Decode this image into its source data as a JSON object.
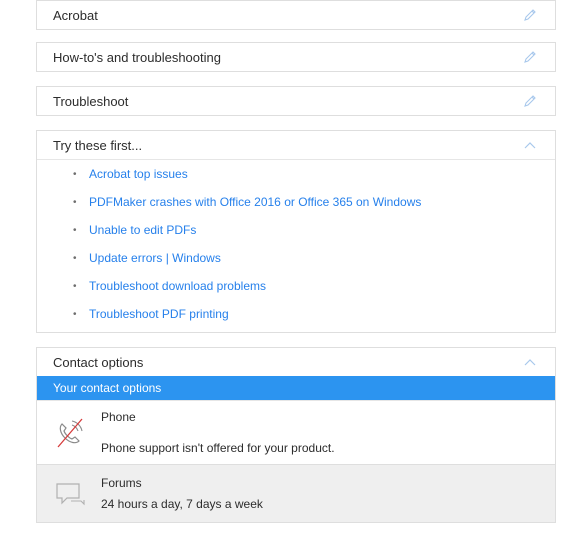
{
  "rows": {
    "acrobat": "Acrobat",
    "howto": "How-to's and troubleshooting",
    "troubleshoot": "Troubleshoot"
  },
  "try_first": {
    "title": "Try these first...",
    "links": [
      "Acrobat top issues",
      "PDFMaker crashes with Office 2016 or Office 365 on Windows",
      "Unable to edit PDFs",
      "Update errors | Windows",
      "Troubleshoot download problems",
      "Troubleshoot PDF printing"
    ]
  },
  "contact": {
    "title": "Contact options",
    "bar_label": "Your contact options",
    "phone": {
      "label": "Phone",
      "note": "Phone support isn't offered for your product."
    },
    "forums": {
      "label": "Forums",
      "hours": "24 hours a day, 7 days a week"
    }
  },
  "icons": {
    "edit": "pencil-icon",
    "collapse": "chevron-up-icon",
    "phone": "phone-disabled-icon",
    "forums": "speech-bubble-icon"
  },
  "colors": {
    "accent": "#2c94f0",
    "link": "#2680eb",
    "border": "#dedede"
  }
}
